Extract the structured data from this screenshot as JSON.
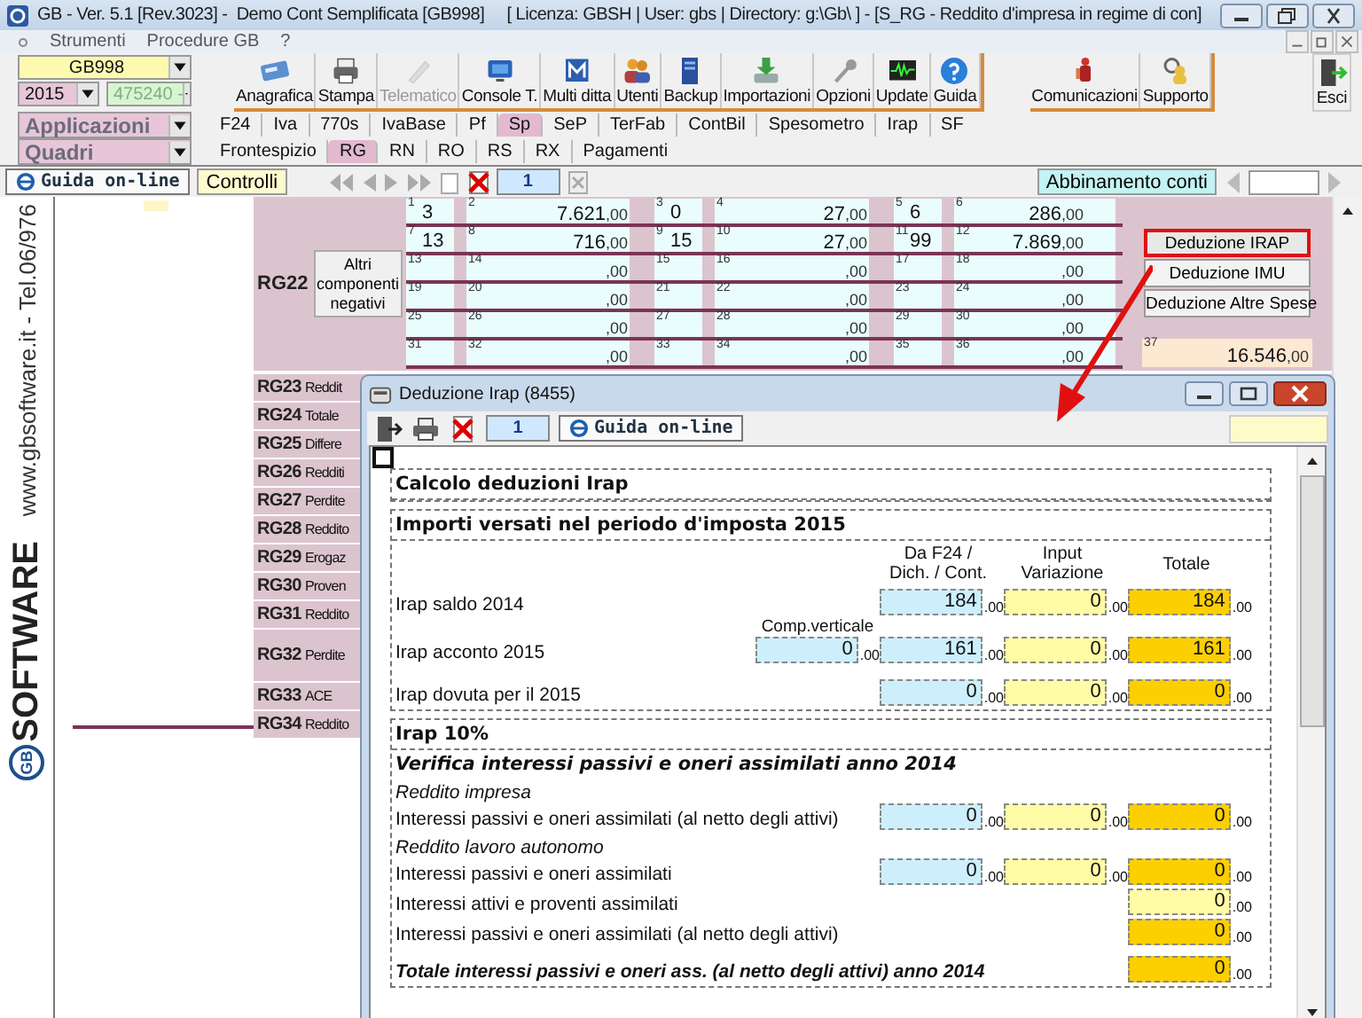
{
  "window": {
    "title": "GB - Ver. 5.1 [Rev.3023] -  Demo Cont Semplificata [GB998]     [ Licenza: GBSH | User: gbs | Directory: g:\\Gb\\ ] - [S_RG - Reddito d'impresa in regime di con]"
  },
  "menu": [
    "Strumenti",
    "Procedure GB",
    "?"
  ],
  "selectors": {
    "company": "GB998",
    "year": "2015",
    "code": "475240 -",
    "applications": "Applicazioni",
    "forms": "Quadri"
  },
  "toolbar": [
    {
      "label": "Anagrafica",
      "disabled": false
    },
    {
      "label": "Stampa",
      "disabled": false
    },
    {
      "label": "Telematico",
      "disabled": true
    },
    {
      "label": "Console T.",
      "disabled": false
    },
    {
      "label": "Multi ditta",
      "disabled": false
    },
    {
      "label": "Utenti",
      "disabled": false
    },
    {
      "label": "Backup",
      "disabled": false
    },
    {
      "label": "Importazioni",
      "disabled": false
    },
    {
      "label": "Opzioni",
      "disabled": false
    },
    {
      "label": "Update",
      "disabled": false
    },
    {
      "label": "Guida",
      "disabled": false
    }
  ],
  "toolbar_extra": [
    {
      "label": "Comunicazioni",
      "disabled": false
    },
    {
      "label": "Supporto",
      "disabled": false
    }
  ],
  "exit": "Esci",
  "app_tabs": [
    {
      "label": "F24",
      "selected": false
    },
    {
      "label": "Iva",
      "selected": false
    },
    {
      "label": "770s",
      "selected": false
    },
    {
      "label": "IvaBase",
      "selected": false
    },
    {
      "label": "Pf",
      "selected": false
    },
    {
      "label": "Sp",
      "selected": true
    },
    {
      "label": "SeP",
      "selected": false
    },
    {
      "label": "TerFab",
      "selected": false
    },
    {
      "label": "ContBil",
      "selected": false
    },
    {
      "label": "Spesometro",
      "selected": false
    },
    {
      "label": "Irap",
      "selected": false
    },
    {
      "label": "SF",
      "selected": false
    }
  ],
  "form_tabs": [
    {
      "label": "Frontespizio",
      "selected": false
    },
    {
      "label": "RG",
      "selected": true
    },
    {
      "label": "RN",
      "selected": false
    },
    {
      "label": "RO",
      "selected": false
    },
    {
      "label": "RS",
      "selected": false
    },
    {
      "label": "RX",
      "selected": false
    },
    {
      "label": "Pagamenti",
      "selected": false
    }
  ],
  "nav": {
    "help": "Guida on-line",
    "checks": "Controlli",
    "page": "1",
    "accounts": "Abbinamento conti"
  },
  "sidebar": {
    "contact": "www.gbsoftware.it - Tel.06/976",
    "logo_mark": "GB",
    "logo_word": "SOFTWARE"
  },
  "rg22": {
    "code": "RG22",
    "button": "Altri componenti negativi",
    "rows": [
      [
        {
          "index": "1",
          "value": "3"
        },
        {
          "index": "2",
          "value": "7.621",
          "dec": ",00"
        },
        {
          "index": "3",
          "value": "0"
        },
        {
          "index": "4",
          "value": "27",
          "dec": ",00"
        },
        {
          "index": "5",
          "value": "6"
        },
        {
          "index": "6",
          "value": "286",
          "dec": ",00"
        }
      ],
      [
        {
          "index": "7",
          "value": "13"
        },
        {
          "index": "8",
          "value": "716",
          "dec": ",00"
        },
        {
          "index": "9",
          "value": "15"
        },
        {
          "index": "10",
          "value": "27",
          "dec": ",00"
        },
        {
          "index": "11",
          "value": "99"
        },
        {
          "index": "12",
          "value": "7.869",
          "dec": ",00"
        }
      ],
      [
        {
          "index": "13"
        },
        {
          "index": "14",
          "dec": ",00"
        },
        {
          "index": "15"
        },
        {
          "index": "16",
          "dec": ",00"
        },
        {
          "index": "17"
        },
        {
          "index": "18",
          "dec": ",00"
        }
      ],
      [
        {
          "index": "19"
        },
        {
          "index": "20",
          "dec": ",00"
        },
        {
          "index": "21"
        },
        {
          "index": "22",
          "dec": ",00"
        },
        {
          "index": "23"
        },
        {
          "index": "24",
          "dec": ",00"
        }
      ],
      [
        {
          "index": "25"
        },
        {
          "index": "26",
          "dec": ",00"
        },
        {
          "index": "27"
        },
        {
          "index": "28",
          "dec": ",00"
        },
        {
          "index": "29"
        },
        {
          "index": "30",
          "dec": ",00"
        }
      ],
      [
        {
          "index": "31"
        },
        {
          "index": "32",
          "dec": ",00"
        },
        {
          "index": "33"
        },
        {
          "index": "34",
          "dec": ",00"
        },
        {
          "index": "35"
        },
        {
          "index": "36",
          "dec": ",00"
        }
      ]
    ],
    "side_buttons": [
      {
        "label": "Deduzione IRAP",
        "highlighted": true
      },
      {
        "label": "Deduzione IMU",
        "highlighted": false
      },
      {
        "label": "Deduzione Altre Spese",
        "highlighted": false
      }
    ],
    "total": {
      "index": "37",
      "value": "16.546",
      "dec": ",00"
    }
  },
  "rows": [
    {
      "code": "RG23",
      "label": "Reddit",
      "tall": false
    },
    {
      "code": "RG24",
      "label": "Totale",
      "tall": false
    },
    {
      "code": "RG25",
      "label": "Differe",
      "tall": false
    },
    {
      "code": "RG26",
      "label": "Redditi",
      "tall": false
    },
    {
      "code": "RG27",
      "label": "Perdite",
      "tall": false
    },
    {
      "code": "RG28",
      "label": "Reddito",
      "tall": false
    },
    {
      "code": "RG29",
      "label": "Erogaz",
      "tall": false
    },
    {
      "code": "RG30",
      "label": "Proven",
      "tall": false
    },
    {
      "code": "RG31",
      "label": "Reddito",
      "tall": false
    },
    {
      "code": "RG32",
      "label": "Perdite",
      "tall": true
    },
    {
      "code": "RG33",
      "label": "ACE",
      "tall": false
    },
    {
      "code": "RG34",
      "label": "Reddito",
      "tall": false
    }
  ],
  "dialog": {
    "title": "Deduzione Irap (8455)",
    "page": "1",
    "marker_checked": false,
    "help": "Guida on-line",
    "heading": "Calcolo deduzioni Irap",
    "paid": {
      "title": "Importi versati nel periodo d'imposta 2015",
      "columns": [
        "Da F24 /\nDich. / Cont.",
        "Input\nVariazione",
        "Totale"
      ],
      "rows": [
        {
          "label": "Irap saldo 2014",
          "cells": [
            {
              "kind": "f24",
              "value": "184",
              "dec": ".00"
            },
            {
              "kind": "input",
              "value": "0",
              "dec": ".00"
            },
            {
              "kind": "total",
              "value": "184",
              "dec": ".00"
            }
          ]
        },
        {
          "label": "Irap acconto 2015",
          "extra": {
            "label": "Comp.verticale",
            "value": "0",
            "dec": ".00"
          },
          "cells": [
            {
              "kind": "f24",
              "value": "161",
              "dec": ".00"
            },
            {
              "kind": "input",
              "value": "0",
              "dec": ".00"
            },
            {
              "kind": "total",
              "value": "161",
              "dec": ".00"
            }
          ]
        },
        {
          "label": "Irap dovuta per il 2015",
          "cells": [
            {
              "kind": "f24",
              "value": "0",
              "dec": ".00"
            },
            {
              "kind": "input",
              "value": "0",
              "dec": ".00"
            },
            {
              "kind": "total",
              "value": "0",
              "dec": ".00"
            }
          ]
        }
      ]
    },
    "irap10": {
      "title": "Irap 10%",
      "subtitle": "Verifica interessi passivi e oneri assimilati anno 2014",
      "items": [
        {
          "kind": "group",
          "label": "Reddito impresa"
        },
        {
          "kind": "row",
          "label": "Interessi passivi e oneri assimilati (al netto degli attivi)",
          "cells": [
            {
              "kind": "f24",
              "value": "0",
              "dec": ".00"
            },
            {
              "kind": "input",
              "value": "0",
              "dec": ".00"
            },
            {
              "kind": "total",
              "value": "0",
              "dec": ".00"
            }
          ]
        },
        {
          "kind": "group",
          "label": "Reddito lavoro autonomo"
        },
        {
          "kind": "row",
          "label": "Interessi passivi e oneri assimilati",
          "cells": [
            {
              "kind": "f24",
              "value": "0",
              "dec": ".00"
            },
            {
              "kind": "input",
              "value": "0",
              "dec": ".00"
            },
            {
              "kind": "total",
              "value": "0",
              "dec": ".00"
            }
          ]
        },
        {
          "kind": "row",
          "label": "Interessi attivi e proventi assimilati",
          "cells": [
            {
              "kind": "input",
              "value": "0",
              "dec": ".00"
            }
          ]
        },
        {
          "kind": "row",
          "label": "Interessi passivi e oneri assimilati (al netto degli attivi)",
          "cells": [
            {
              "kind": "total",
              "value": "0",
              "dec": ".00"
            }
          ]
        },
        {
          "kind": "total",
          "label": "Totale interessi passivi e oneri ass. (al netto degli attivi) anno 2014",
          "cells": [
            {
              "kind": "total",
              "value": "0",
              "dec": ".00"
            }
          ]
        }
      ]
    }
  }
}
